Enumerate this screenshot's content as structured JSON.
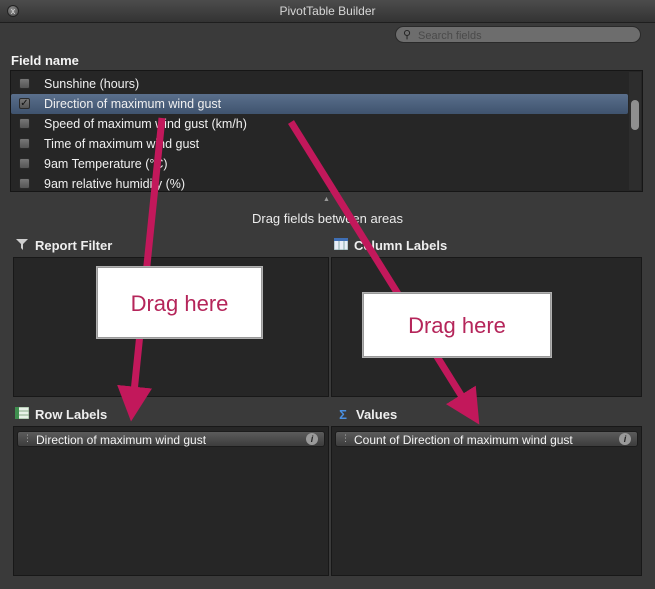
{
  "window": {
    "title": "PivotTable Builder",
    "close_glyph": "x"
  },
  "search": {
    "placeholder": "Search fields",
    "icon": "magnifier-icon"
  },
  "field_list": {
    "header": "Field name",
    "items": [
      {
        "label": "Sunshine (hours)",
        "checked": false
      },
      {
        "label": "Direction of maximum wind gust",
        "checked": true,
        "selected": true
      },
      {
        "label": "Speed of maximum wind gust (km/h)",
        "checked": false
      },
      {
        "label": "Time of maximum wind gust",
        "checked": false
      },
      {
        "label": "9am Temperature (°C)",
        "checked": false
      },
      {
        "label": "9am relative humidity (%)",
        "checked": false
      }
    ]
  },
  "hint": "Drag fields between areas",
  "areas": {
    "report_filter": {
      "title": "Report Filter",
      "icon": "filter-icon"
    },
    "column_labels": {
      "title": "Column Labels",
      "icon": "column-table-icon"
    },
    "row_labels": {
      "title": "Row Labels",
      "icon": "row-table-icon",
      "field": "Direction of maximum wind gust"
    },
    "values": {
      "title": "Values",
      "icon": "sigma-icon",
      "field": "Count of Direction of maximum wind gust"
    }
  },
  "annotations": {
    "callout_left": "Drag here",
    "callout_right": "Drag here",
    "arrow_color": "#c2185b"
  },
  "colors": {
    "accent_selection": "#4f6684",
    "callout_text": "#b5255a"
  }
}
